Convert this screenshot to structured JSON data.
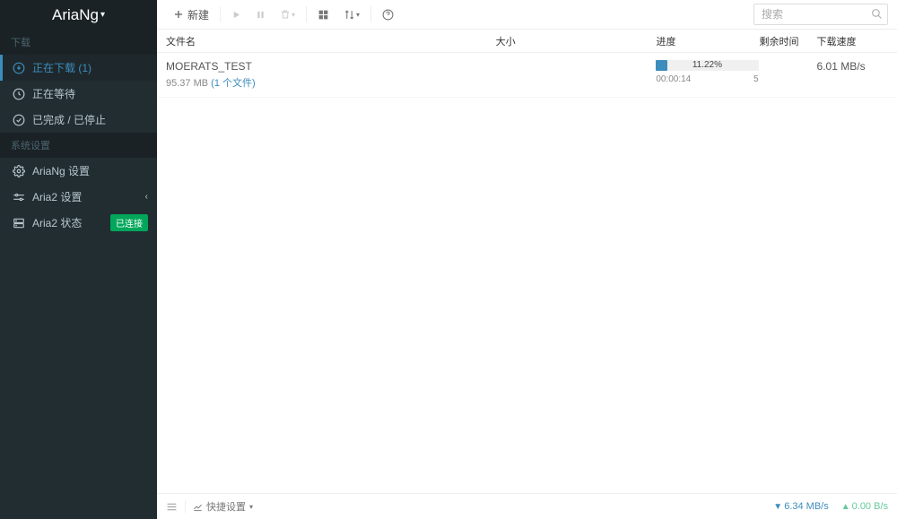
{
  "app": {
    "name": "AriaNg"
  },
  "toolbar": {
    "new_label": "新建"
  },
  "search": {
    "placeholder": "搜索"
  },
  "sidebar": {
    "sections": {
      "downloads": "下载",
      "system": "系统设置"
    },
    "items": [
      {
        "label": "正在下载 (1)"
      },
      {
        "label": "正在等待"
      },
      {
        "label": "已完成 / 已停止"
      },
      {
        "label": "AriaNg 设置"
      },
      {
        "label": "Aria2 设置"
      },
      {
        "label": "Aria2 状态",
        "badge": "已连接"
      }
    ]
  },
  "table": {
    "headers": {
      "name": "文件名",
      "size": "大小",
      "progress": "进度",
      "remaining": "剩余时间",
      "speed": "下载速度"
    },
    "rows": [
      {
        "name": "MOERATS_TEST",
        "size": "95.37 MB",
        "files": "(1 个文件)",
        "progress_pct": "11.22%",
        "progress_width": "11.22%",
        "elapsed": "00:00:14",
        "remain_short": "5",
        "speed": "6.01 MB/s"
      }
    ]
  },
  "footer": {
    "quick_settings": "快捷设置",
    "download_speed": "6.34 MB/s",
    "upload_speed": "0.00 B/s"
  }
}
